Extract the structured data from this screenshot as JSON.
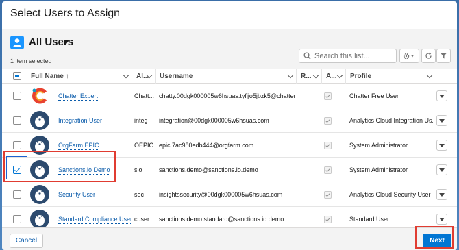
{
  "modal": {
    "title": "Select Users to Assign"
  },
  "list_view": {
    "name": "All Users",
    "selected_count": "1 item selected",
    "search_placeholder": "Search this list...",
    "object_icon": "user-icon"
  },
  "columns": [
    {
      "label": "Full Name",
      "sort": "ascending"
    },
    {
      "label": "Al..."
    },
    {
      "label": "Username"
    },
    {
      "label": "R..."
    },
    {
      "label": "A..."
    },
    {
      "label": "Profile"
    }
  ],
  "rows": [
    {
      "selected": false,
      "avatar": "chatter-avatar",
      "full_name": "Chatter Expert",
      "alias": "Chatt...",
      "username": "chatty.00dgk000005w6hsuas.tyfjjo5jbzk5@chatter....",
      "active": true,
      "profile": "Chatter Free User"
    },
    {
      "selected": false,
      "avatar": "bear-avatar",
      "full_name": "Integration User",
      "alias": "integ",
      "username": "integration@00dgk000005w6hsuas.com",
      "active": true,
      "profile": "Analytics Cloud Integration Us..."
    },
    {
      "selected": false,
      "avatar": "bear-avatar",
      "full_name": "OrgFarm EPIC",
      "alias": "OEPIC",
      "username": "epic.7ac980edb444@orgfarm.com",
      "active": true,
      "profile": "System Administrator"
    },
    {
      "selected": true,
      "avatar": "bear-avatar",
      "full_name": "Sanctions.io Demo",
      "alias": "sio",
      "username": "sanctions.demo@sanctions.io.demo",
      "active": true,
      "profile": "System Administrator"
    },
    {
      "selected": false,
      "avatar": "bear-avatar",
      "full_name": "Security User",
      "alias": "sec",
      "username": "insightssecurity@00dgk000005w6hsuas.com",
      "active": true,
      "profile": "Analytics Cloud Security User"
    },
    {
      "selected": false,
      "avatar": "bear-avatar",
      "full_name": "Standard Compliance User",
      "alias": "cuser",
      "username": "sanctions.demo.standard@sanctions.io.demo",
      "active": true,
      "profile": "Standard User"
    }
  ],
  "footer": {
    "cancel_label": "Cancel",
    "next_label": "Next"
  },
  "colors": {
    "brand": "#0176d3",
    "link": "#0b5cab",
    "annotation": "#e03c31"
  }
}
